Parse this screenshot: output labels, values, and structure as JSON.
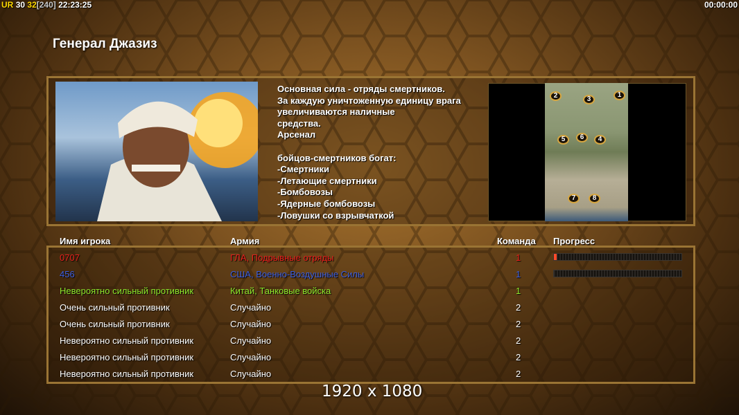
{
  "overlay": {
    "ur_label": "UR",
    "fps1": "30",
    "fps2": "32",
    "fps3": "[240]",
    "clock": "22:23:25",
    "timer": "00:00:00"
  },
  "general": {
    "title": "Генерал Джазиз",
    "description": "Основная сила - отряды смертников.\nЗа каждую уничтоженную единицу врага\n увеличиваются наличные\nсредства.\nАрсенал\n\nбойцов-смертников богат:\n-Смертники\n-Летающие смертники\n-Бомбовозы\n-Ядерные бомбовозы\n-Ловушки со взрывчаткой"
  },
  "minimap": {
    "start_positions": [
      "1",
      "2",
      "3",
      "4",
      "5",
      "6",
      "7",
      "8"
    ]
  },
  "table": {
    "headers": {
      "player": "Имя игрока",
      "army": "Армия",
      "team": "Команда",
      "progress": "Прогресс"
    },
    "rows": [
      {
        "player": "0707",
        "army": "ГЛА, Подрывные отряды",
        "team": "1",
        "progress": 0.02,
        "color": "#e8211c",
        "show_progress": true
      },
      {
        "player": "456",
        "army": "США, Военно-Воздушные Силы",
        "team": "1",
        "progress": 0.0,
        "color": "#3d5fe0",
        "show_progress": true
      },
      {
        "player": "Невероятно сильный противник",
        "army": "Китай, Танковые войска",
        "team": "1",
        "color": "#8ee82c",
        "show_progress": false
      },
      {
        "player": "Очень сильный противник",
        "army": "Случайно",
        "team": "2",
        "color": "#ffffff",
        "show_progress": false
      },
      {
        "player": "Очень сильный противник",
        "army": "Случайно",
        "team": "2",
        "color": "#ffffff",
        "show_progress": false
      },
      {
        "player": "Невероятно сильный противник",
        "army": "Случайно",
        "team": "2",
        "color": "#ffffff",
        "show_progress": false
      },
      {
        "player": "Невероятно сильный противник",
        "army": "Случайно",
        "team": "2",
        "color": "#ffffff",
        "show_progress": false
      },
      {
        "player": "Невероятно сильный противник",
        "army": "Случайно",
        "team": "2",
        "color": "#ffffff",
        "show_progress": false
      }
    ]
  },
  "resolution": "1920 x 1080"
}
